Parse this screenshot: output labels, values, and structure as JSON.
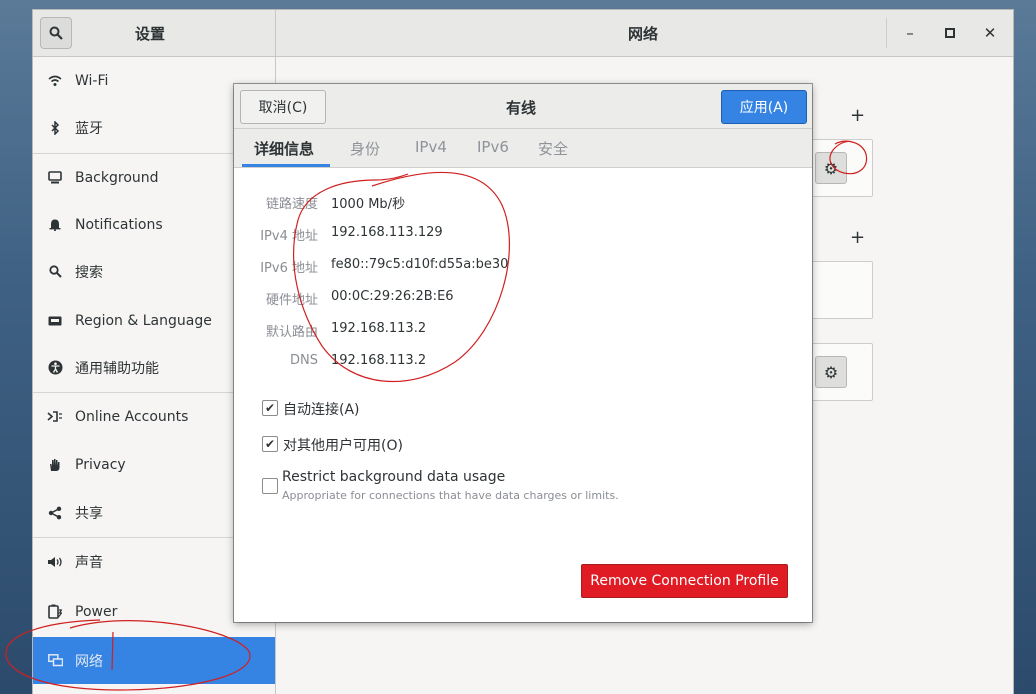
{
  "window": {
    "settings_title": "设置",
    "network_title": "网络",
    "controls": {
      "minimize": "–",
      "maximize": "▫",
      "close": "×"
    }
  },
  "sidebar": {
    "items": [
      {
        "label": "Wi-Fi",
        "icon": "wifi-icon"
      },
      {
        "label": "蓝牙",
        "icon": "bluetooth-icon"
      },
      {
        "label": "Background",
        "icon": "display-icon"
      },
      {
        "label": "Notifications",
        "icon": "bell-icon"
      },
      {
        "label": "搜索",
        "icon": "search-icon"
      },
      {
        "label": "Region & Language",
        "icon": "keyboard-icon"
      },
      {
        "label": "通用辅助功能",
        "icon": "accessibility-icon"
      },
      {
        "label": "Online Accounts",
        "icon": "online-accounts-icon"
      },
      {
        "label": "Privacy",
        "icon": "hand-icon"
      },
      {
        "label": "共享",
        "icon": "share-icon"
      },
      {
        "label": "声音",
        "icon": "speaker-icon"
      },
      {
        "label": "Power",
        "icon": "power-icon"
      },
      {
        "label": "网络",
        "icon": "network-icon",
        "active": true
      }
    ]
  },
  "main": {
    "add_symbol": "+"
  },
  "dialog": {
    "title": "有线",
    "cancel_label": "取消(C)",
    "apply_label": "应用(A)",
    "tabs": [
      "详细信息",
      "身份",
      "IPv4",
      "IPv6",
      "安全"
    ],
    "active_tab": 0,
    "details": [
      {
        "label": "链路速度",
        "value": "1000 Mb/秒"
      },
      {
        "label": "IPv4 地址",
        "value": "192.168.113.129"
      },
      {
        "label": "IPv6 地址",
        "value": "fe80::79c5:d10f:d55a:be30"
      },
      {
        "label": "硬件地址",
        "value": "00:0C:29:26:2B:E6"
      },
      {
        "label": "默认路由",
        "value": "192.168.113.2"
      },
      {
        "label": "DNS",
        "value": "192.168.113.2"
      }
    ],
    "checkboxes": [
      {
        "label": "自动连接(A)",
        "checked": true
      },
      {
        "label": "对其他用户可用(O)",
        "checked": true
      },
      {
        "label": "Restrict background data usage",
        "sub": "Appropriate for connections that have data charges or limits.",
        "checked": false
      }
    ],
    "remove_label": "Remove Connection Profile"
  },
  "colors": {
    "accent": "#3584e4",
    "destructive": "#e01b24",
    "annotation": "#d02020"
  }
}
